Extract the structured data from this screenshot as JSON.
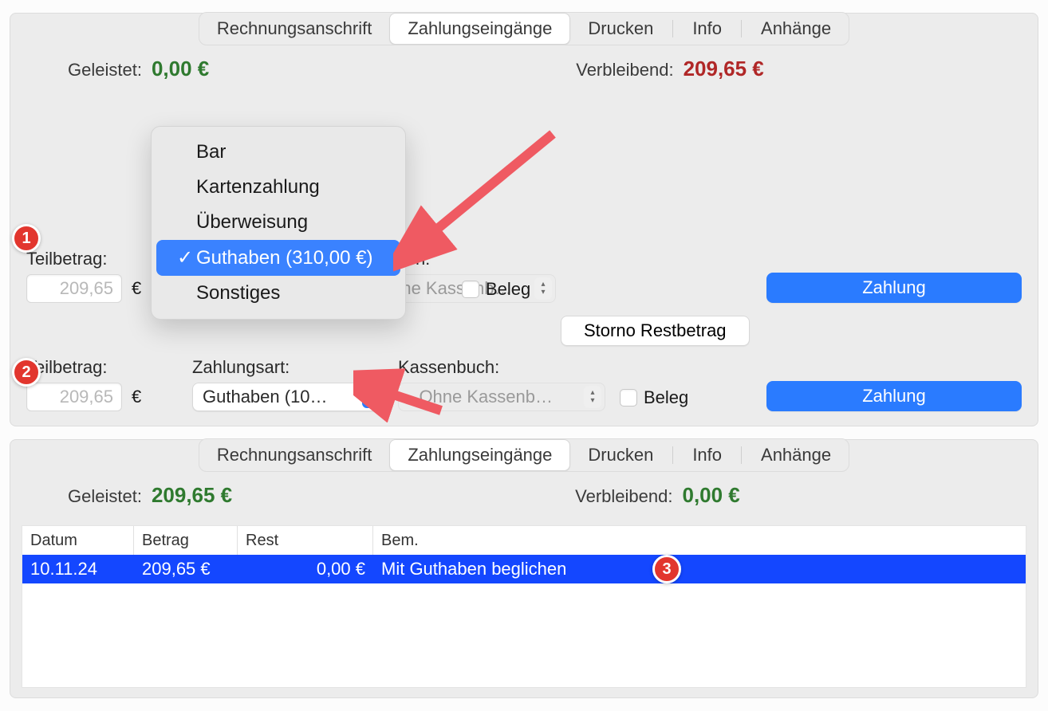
{
  "tabs": {
    "t1": "Rechnungsanschrift",
    "t2": "Zahlungseingänge",
    "t3": "Drucken",
    "t4": "Info",
    "t5": "Anhänge"
  },
  "panel1": {
    "paid_label": "Geleistet:",
    "paid_value": "0,00 €",
    "remain_label": "Verbleibend:",
    "remain_value": "209,65 €",
    "teil_label": "Teilbetrag:",
    "teil_value": "209,65",
    "currency": "€",
    "kassen_label": "enbuch:",
    "kassen_value": "Ohne Kassenb…",
    "beleg_label": "Beleg",
    "pay_button": "Zahlung",
    "storno_button": "Storno Restbetrag",
    "popup": {
      "o1": "Bar",
      "o2": "Kartenzahlung",
      "o3": "Überweisung",
      "o4": "Guthaben (310,00 €)",
      "o5": "Sonstiges"
    }
  },
  "panel1b": {
    "teil_label": "Teilbetrag:",
    "teil_value": "209,65",
    "currency": "€",
    "zart_label": "Zahlungsart:",
    "zart_value": "Guthaben (10…",
    "kassen_label": "Kassenbuch:",
    "kassen_value": "- Ohne Kassenb…",
    "beleg_label": "Beleg",
    "pay_button": "Zahlung"
  },
  "panel2": {
    "paid_label": "Geleistet:",
    "paid_value": "209,65 €",
    "remain_label": "Verbleibend:",
    "remain_value": "0,00 €",
    "table": {
      "h1": "Datum",
      "h2": "Betrag",
      "h3": "Rest",
      "h4": "Bem.",
      "r1_date": "10.11.24",
      "r1_amount": "209,65 €",
      "r1_rest": "0,00 €",
      "r1_note": "Mit Guthaben beglichen"
    }
  },
  "badges": {
    "b1": "1",
    "b2": "2",
    "b3": "3"
  }
}
